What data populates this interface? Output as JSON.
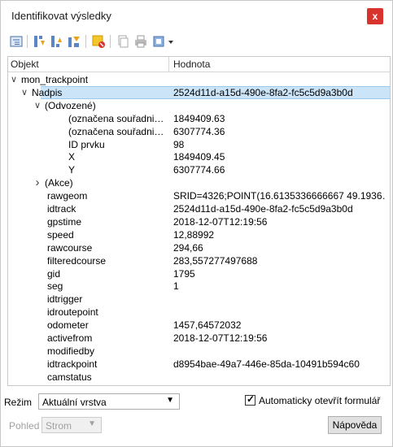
{
  "window": {
    "title": "Identifikovat výsledky",
    "close_label": "x"
  },
  "toolbar": {
    "buttons": [
      {
        "icon": "expand-tree-icon"
      },
      {
        "icon": "expand-all-icon"
      },
      {
        "icon": "collapse-all-icon"
      },
      {
        "icon": "expand-new-icon"
      },
      {
        "icon": "highlight-clear-icon"
      },
      {
        "icon": "copy-feature-icon"
      },
      {
        "icon": "print-icon"
      },
      {
        "icon": "select-mode-icon"
      }
    ]
  },
  "tree": {
    "header": {
      "object": "Objekt",
      "value": "Hodnota"
    },
    "rows": [
      {
        "indent": 0,
        "expander": "v",
        "object": "mon_trackpoint",
        "value": ""
      },
      {
        "indent": 1,
        "expander": "v",
        "object": "Nadpis",
        "value": "2524d11d-a15d-490e-8fa2-fc5c5d9a3b0d",
        "selected": true
      },
      {
        "indent": 2,
        "expander": "v",
        "object": "(Odvozené)",
        "value": ""
      },
      {
        "indent": 4,
        "expander": "",
        "object": "(označena souřadni…",
        "value": "1849409.63"
      },
      {
        "indent": 4,
        "expander": "",
        "object": "(označena souřadni…",
        "value": "6307774.36"
      },
      {
        "indent": 4,
        "expander": "",
        "object": "ID prvku",
        "value": "98"
      },
      {
        "indent": 4,
        "expander": "",
        "object": "X",
        "value": "1849409.45"
      },
      {
        "indent": 4,
        "expander": "",
        "object": "Y",
        "value": "6307774.66"
      },
      {
        "indent": 2,
        "expander": ">",
        "object": "(Akce)",
        "value": ""
      },
      {
        "indent": 3,
        "expander": "",
        "object": "rawgeom",
        "value": "SRID=4326;POINT(16.6135336666667 49.1936…"
      },
      {
        "indent": 3,
        "expander": "",
        "object": "idtrack",
        "value": "2524d11d-a15d-490e-8fa2-fc5c5d9a3b0d"
      },
      {
        "indent": 3,
        "expander": "",
        "object": "gpstime",
        "value": "2018-12-07T12:19:56"
      },
      {
        "indent": 3,
        "expander": "",
        "object": "speed",
        "value": "12,88992"
      },
      {
        "indent": 3,
        "expander": "",
        "object": "rawcourse",
        "value": "294,66"
      },
      {
        "indent": 3,
        "expander": "",
        "object": "filteredcourse",
        "value": "283,557277497688"
      },
      {
        "indent": 3,
        "expander": "",
        "object": "gid",
        "value": "1795"
      },
      {
        "indent": 3,
        "expander": "",
        "object": "seg",
        "value": "1"
      },
      {
        "indent": 3,
        "expander": "",
        "object": "idtrigger",
        "value": ""
      },
      {
        "indent": 3,
        "expander": "",
        "object": "idroutepoint",
        "value": ""
      },
      {
        "indent": 3,
        "expander": "",
        "object": "odometer",
        "value": "1457,64572032"
      },
      {
        "indent": 3,
        "expander": "",
        "object": "activefrom",
        "value": "2018-12-07T12:19:56"
      },
      {
        "indent": 3,
        "expander": "",
        "object": "modifiedby",
        "value": ""
      },
      {
        "indent": 3,
        "expander": "",
        "object": "idtrackpoint",
        "value": "d8954bae-49a7-446e-85da-10491b594c60"
      },
      {
        "indent": 3,
        "expander": "",
        "object": "camstatus",
        "value": ""
      }
    ]
  },
  "bottom": {
    "mode_label": "Režim",
    "mode_value": "Aktuální vrstva",
    "auto_open_label": "Automaticky otevřít formulář",
    "auto_open_checked": true,
    "view_label": "Pohled",
    "view_value": "Strom",
    "help_button": "Nápověda"
  }
}
